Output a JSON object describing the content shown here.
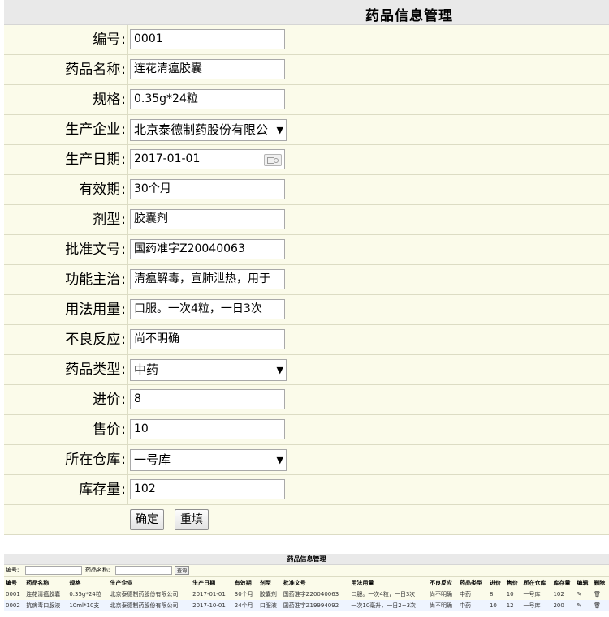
{
  "form": {
    "title": "药品信息管理",
    "fields": [
      {
        "label": "编号",
        "value": "0001",
        "kind": "text"
      },
      {
        "label": "药品名称",
        "value": "连花清瘟胶囊",
        "kind": "text"
      },
      {
        "label": "规格",
        "value": "0.35g*24粒",
        "kind": "text"
      },
      {
        "label": "生产企业",
        "value": "北京泰德制药股份有限公",
        "kind": "select"
      },
      {
        "label": "生产日期",
        "value": "2017-01-01",
        "kind": "date"
      },
      {
        "label": "有效期",
        "value": "30个月",
        "kind": "text"
      },
      {
        "label": "剂型",
        "value": "胶囊剂",
        "kind": "text"
      },
      {
        "label": "批准文号",
        "value": "国药准字Z20040063",
        "kind": "text"
      },
      {
        "label": "功能主治",
        "value": "清瘟解毒，宣肺泄热，用于",
        "kind": "text"
      },
      {
        "label": "用法用量",
        "value": "口服。一次4粒，一日3次",
        "kind": "text"
      },
      {
        "label": "不良反应",
        "value": "尚不明确",
        "kind": "text"
      },
      {
        "label": "药品类型",
        "value": "中药",
        "kind": "select"
      },
      {
        "label": "进价",
        "value": "8",
        "kind": "text"
      },
      {
        "label": "售价",
        "value": "10",
        "kind": "text"
      },
      {
        "label": "所在仓库",
        "value": "一号库",
        "kind": "select"
      },
      {
        "label": "库存量",
        "value": "102",
        "kind": "text"
      }
    ],
    "confirm_label": "确定",
    "reset_label": "重填",
    "colon": ":",
    "select_arrow": "▼"
  },
  "list": {
    "title": "药品信息管理",
    "search_id_label": "编号:",
    "search_name_label": "药品名称:",
    "search_button": "查询",
    "columns": [
      "编号",
      "药品名称",
      "规格",
      "生产企业",
      "生产日期",
      "有效期",
      "剂型",
      "批准文号",
      "用法用量",
      "不良反应",
      "药品类型",
      "进价",
      "售价",
      "所在仓库",
      "库存量",
      "编辑",
      "删除"
    ],
    "rows": [
      [
        "0001",
        "连花清瘟胶囊",
        "0.35g*24粒",
        "北京泰德制药股份有限公司",
        "2017-01-01",
        "30个月",
        "胶囊剂",
        "国药准字Z20040063",
        "口服。一次4粒，一日3次",
        "尚不明确",
        "中药",
        "8",
        "10",
        "一号库",
        "102"
      ],
      [
        "0002",
        "抗病毒口服液",
        "10ml*10支",
        "北京泰德制药股份有限公司",
        "2017-10-01",
        "24个月",
        "口服液",
        "国药准字Z19994092",
        "一次10毫升，一日2~3次",
        "尚不明确",
        "中药",
        "10",
        "12",
        "一号库",
        "200"
      ]
    ],
    "edit_icon": "✎",
    "delete_icon": "🗑"
  }
}
